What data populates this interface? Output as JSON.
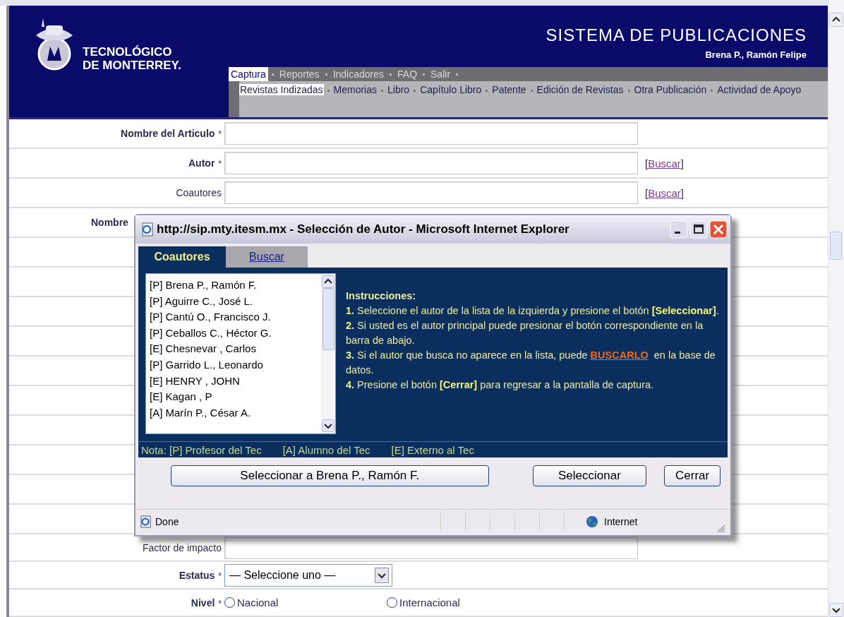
{
  "header": {
    "institution": [
      "TECNOLÓGICO",
      "DE MONTERREY."
    ],
    "title": "SISTEMA DE PUBLICACIONES",
    "user": "Brena P., Ramón Felipe"
  },
  "menu": [
    {
      "label": "Captura",
      "selected": true
    },
    {
      "label": "Reportes",
      "selected": false
    },
    {
      "label": "Indicadores",
      "selected": false
    },
    {
      "label": "FAQ",
      "selected": false
    },
    {
      "label": "Salir",
      "selected": false
    }
  ],
  "submenu": [
    {
      "label": "Revistas Indizadas",
      "selected": true
    },
    {
      "label": "Memorias",
      "selected": false
    },
    {
      "label": "Libro",
      "selected": false
    },
    {
      "label": "Capítulo Libro",
      "selected": false
    },
    {
      "label": "Patente",
      "selected": false
    },
    {
      "label": "Edición de Revistas",
      "selected": false
    },
    {
      "label": "Otra Publicación",
      "selected": false
    },
    {
      "label": "Actividad de Apoyo",
      "selected": false
    }
  ],
  "form": {
    "rows_top": [
      {
        "kind": "text",
        "label": "Nombre del Articulo",
        "marker": "*",
        "bold": true
      },
      {
        "kind": "text",
        "label": "Autor",
        "marker": "*",
        "bold": true,
        "action": {
          "before": "[",
          "link": "Buscar",
          "after": "]"
        }
      },
      {
        "kind": "text",
        "label": "Coautores",
        "bold": false,
        "action": {
          "before": "[",
          "link": "Buscar",
          "after": "]"
        }
      },
      {
        "kind": "covered",
        "label": "Nombre",
        "bold": true
      }
    ],
    "rows_bottom": [
      {
        "kind": "text",
        "label": "Factor de impacto",
        "bold": false
      },
      {
        "kind": "select",
        "label": "Estatus",
        "marker": "*",
        "bold": true,
        "value": "— Seleccione uno —"
      },
      {
        "kind": "radio",
        "label": "Nivel",
        "marker": "*",
        "bold": true,
        "options": [
          {
            "label": "Nacional",
            "selected": false
          },
          {
            "label": "Internacional",
            "selected": false
          }
        ]
      }
    ]
  },
  "popup": {
    "title": "http://sip.mty.itesm.mx - Selección de Autor - Microsoft Internet Explorer",
    "tabs": [
      {
        "label": "Coautores",
        "selected": true
      },
      {
        "label": "Buscar",
        "selected": false
      }
    ],
    "authors": [
      "[P] Brena P., Ramón F.",
      "[P] Aguirre C., José L.",
      "[P] Cantú O., Francisco J.",
      "[P] Ceballos C., Héctor G.",
      "[E] Chesnevar , Carlos",
      "[P] Garrido L., Leonardo",
      "[E] HENRY , JOHN",
      "[E] Kagan , P",
      "[A] Marín P., César A."
    ],
    "instructions_title": "Instrucciones:",
    "instructions": [
      {
        "text": "**1.** Seleccione el autor de la lista de la izquierda y presione el botón **[Seleccionar]**."
      },
      {
        "text": "**2.** Si usted es el autor principal puede presionar el botón correspondiente en la barra de abajo."
      },
      {
        "text": "**3.** Si el autor que busca no aparece en la lista, puede",
        "link": "BUSCARLO",
        "after": "en la base de datos."
      },
      {
        "text": "**4.** Presione el botón **[Cerrar]** para regresar a la pantalla de captura."
      }
    ],
    "notes": [
      "Nota: [P] Profesor del Tec",
      "[A] Alumno del Tec",
      "[E] Externo al Tec"
    ],
    "buttons": [
      {
        "kind": "wide",
        "label": "Seleccionar a Brena P., Ramón F."
      },
      {
        "kind": "normal",
        "label": "Seleccionar"
      },
      {
        "kind": "normal",
        "label": "Cerrar"
      }
    ],
    "status": {
      "left": "Done",
      "zone": "Internet"
    }
  }
}
